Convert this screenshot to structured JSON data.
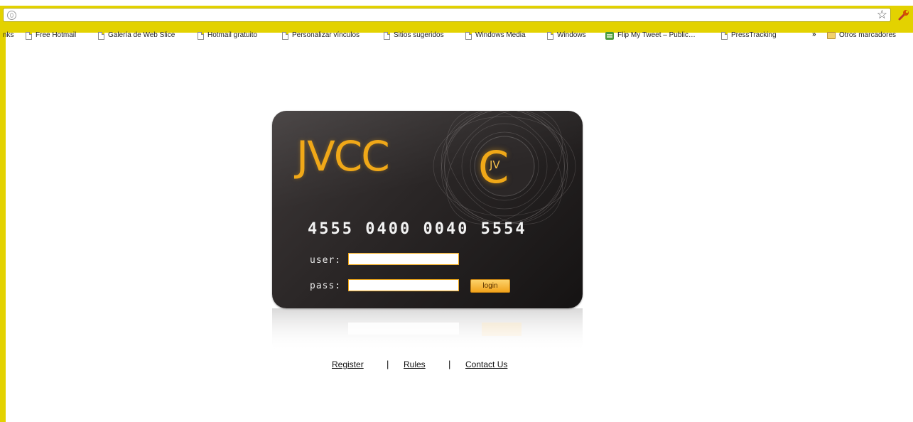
{
  "browser": {
    "star_glyph": "☆",
    "bookmarks_bar": {
      "items": [
        {
          "label": "nks",
          "icon": "none"
        },
        {
          "label": "Free Hotmail",
          "icon": "page-icon"
        },
        {
          "label": "Galería de Web Slice",
          "icon": "page-icon"
        },
        {
          "label": "Hotmail gratuito",
          "icon": "page-icon"
        },
        {
          "label": "Personalizar vínculos",
          "icon": "page-icon"
        },
        {
          "label": "Sitios sugeridos",
          "icon": "page-icon"
        },
        {
          "label": "Windows Media",
          "icon": "page-icon"
        },
        {
          "label": "Windows",
          "icon": "page-icon"
        },
        {
          "label": "Flip My Tweet – Public…",
          "icon": "flip-icon"
        },
        {
          "label": "PressTracking",
          "icon": "page-icon"
        }
      ],
      "more_glyph": "»",
      "other_bookmarks": "Otros marcadores"
    },
    "theme_color": "#e3d200"
  },
  "card": {
    "logo": "JVCC",
    "emblem_letter": "C",
    "emblem_text": "JV",
    "number": "4555 0400 0040 5554",
    "user_label": "user:",
    "pass_label": "pass:",
    "user_value": "",
    "pass_value": "",
    "login_label": "login",
    "accent_color": "#f0a818"
  },
  "footer": {
    "links": [
      "Register",
      "Rules",
      "Contact Us"
    ],
    "separator": "|"
  }
}
